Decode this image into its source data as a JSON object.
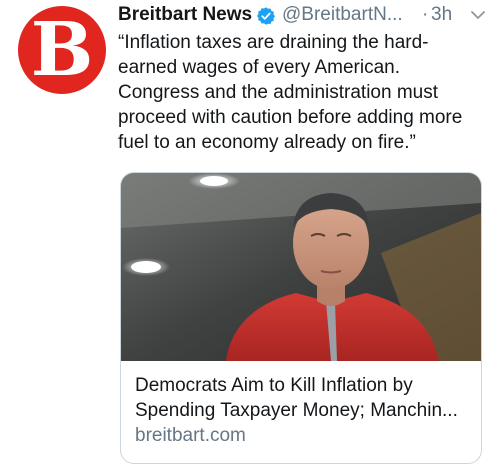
{
  "account": {
    "display_name": "Breitbart News",
    "handle": "@BreitbartN...",
    "separator": "·",
    "time": "3h",
    "avatar_letter": "B",
    "avatar_color": "#e0261f",
    "verified_icon": "verified-badge-icon",
    "menu_icon": "chevron-down-icon"
  },
  "tweet": {
    "lines": [
      "“Inflation taxes are draining the hard-",
      "earned wages of every American.",
      "Congress and the administration must",
      "proceed with caution before adding more",
      "fuel to an economy already on fire.”"
    ]
  },
  "card": {
    "title_lines": [
      "Democrats Aim to Kill Inflation by",
      "Spending Taxpayer Money; Manchin..."
    ],
    "domain": "breitbart.com"
  },
  "colors": {
    "verified_blue": "#1da1f2",
    "secondary_text": "#657786",
    "card_border": "#ccd6dd",
    "jacket_red": "#c8322e"
  }
}
